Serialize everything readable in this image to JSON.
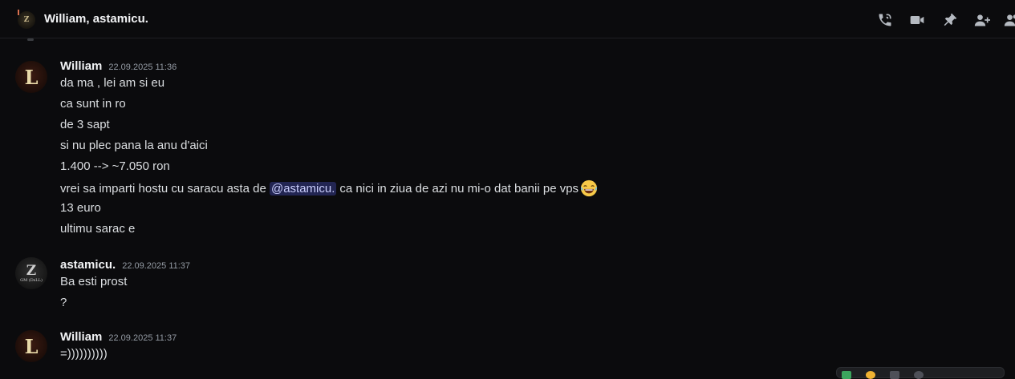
{
  "header": {
    "avatar_letter": "Z",
    "title": "William, astamicu."
  },
  "icons": [
    "phone-call-icon",
    "video-camera-icon",
    "pin-icon",
    "add-friends-icon",
    "members-icon"
  ],
  "messages": [
    {
      "author": "William",
      "timestamp": "22.09.2025 11:36",
      "avatar_letter": "L",
      "lines": [
        "da ma , lei am si eu",
        "ca sunt in ro",
        "de 3 sapt",
        "si nu plec pana la anu d'aici",
        "1.400 --> ~7.050 ron",
        {
          "before": "vrei sa imparti hostu cu saracu asta de ",
          "mention": "@astamicu.",
          "after": "ca nici in ziua de azi nu mi-o dat banii pe vps",
          "emoji": "joy-emoji"
        },
        "13 euro",
        "ultimu sarac e"
      ]
    },
    {
      "author": "astamicu.",
      "timestamp": "22.09.2025 11:37",
      "avatar_letter": "Z",
      "avatar_subtext": "GM (DsLL)",
      "lines": [
        "Ba esti prost",
        "?"
      ]
    },
    {
      "author": "William",
      "timestamp": "22.09.2025 11:37",
      "avatar_letter": "L",
      "lines": [
        "=))))))))))"
      ]
    }
  ],
  "colors": {
    "background": "#0b0b0d",
    "mention_bg": "#5865f2",
    "name": "#f2f3f5",
    "text": "#dbdee1",
    "timestamp": "#949ba4"
  }
}
